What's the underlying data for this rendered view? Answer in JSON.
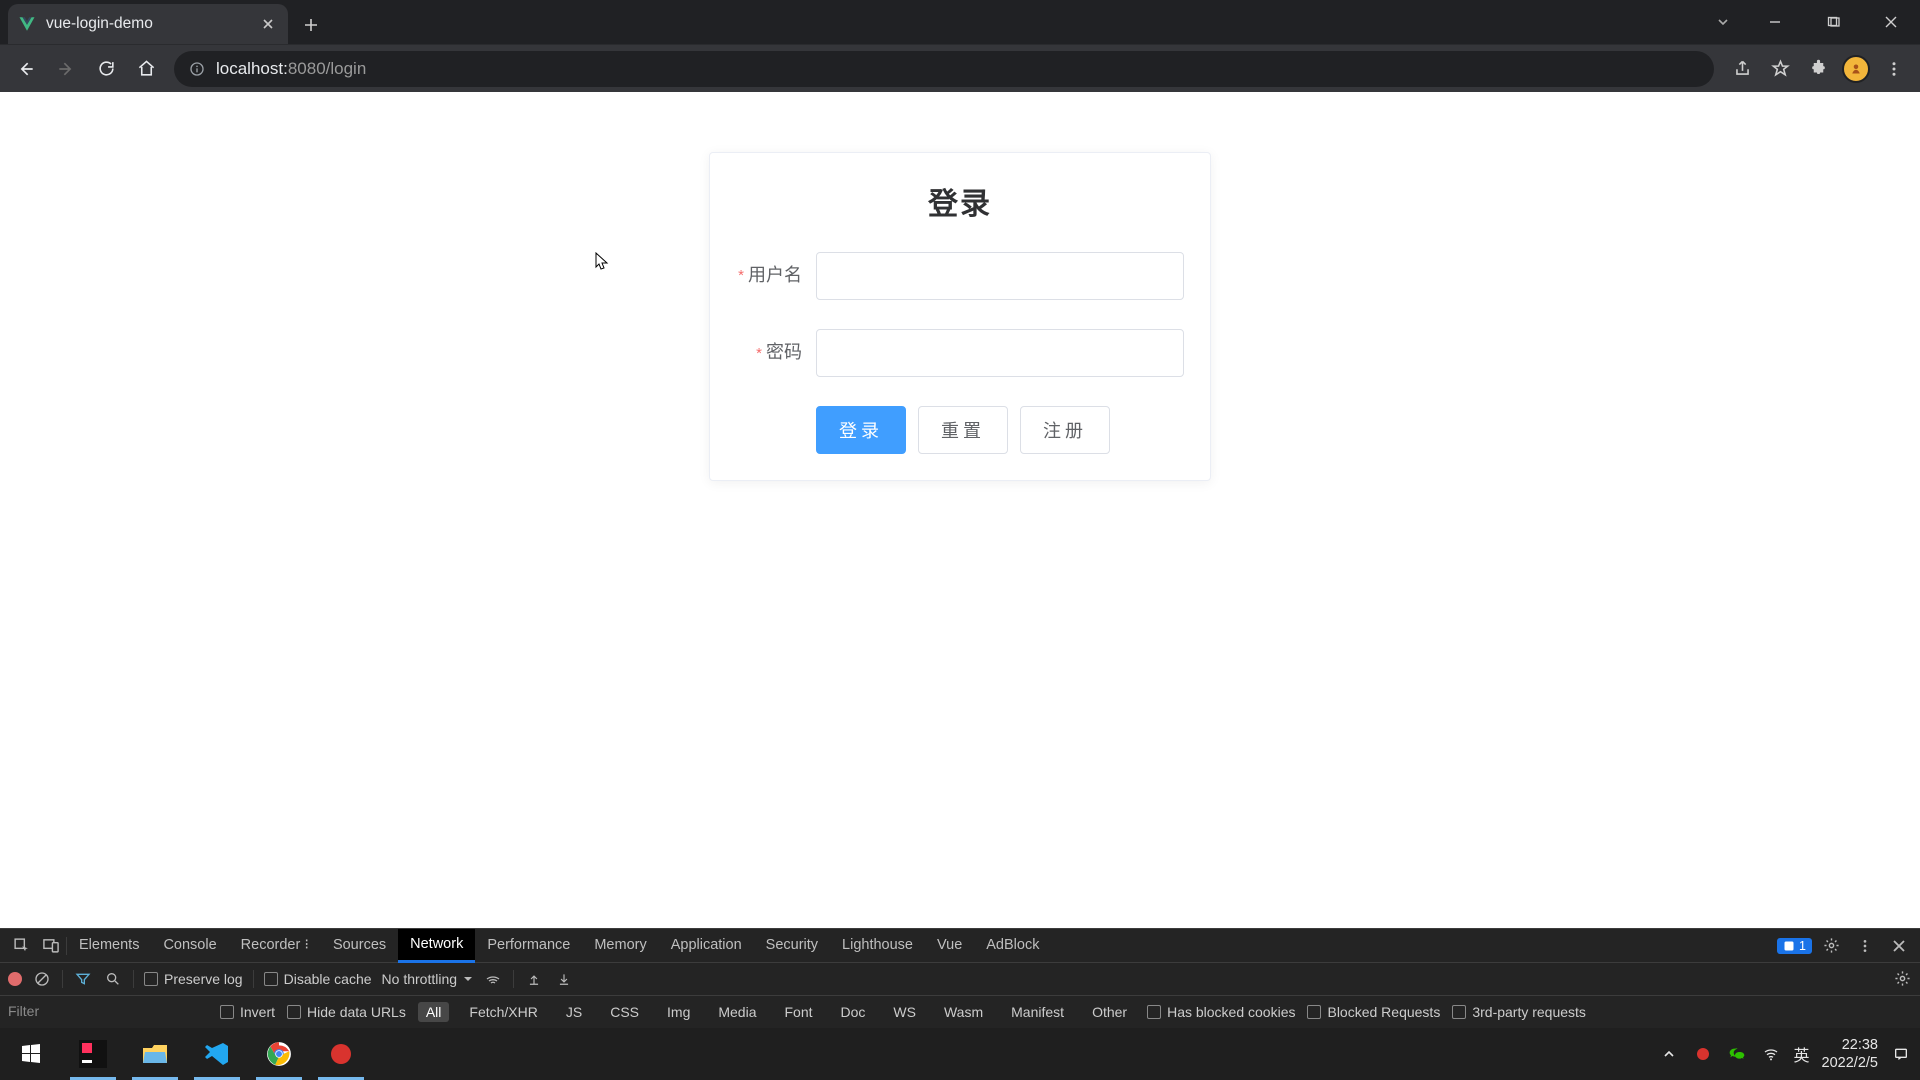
{
  "browser": {
    "tab_title": "vue-login-demo",
    "url_host": "localhost:",
    "url_port_path": "8080/login"
  },
  "page": {
    "title": "登录",
    "username_label": "用户名",
    "password_label": "密码",
    "username_value": "",
    "password_value": "",
    "btn_login": "登录",
    "btn_reset": "重置",
    "btn_register": "注册"
  },
  "devtools": {
    "tabs": {
      "elements": "Elements",
      "console": "Console",
      "recorder": "Recorder",
      "sources": "Sources",
      "network": "Network",
      "performance": "Performance",
      "memory": "Memory",
      "application": "Application",
      "security": "Security",
      "lighthouse": "Lighthouse",
      "vue": "Vue",
      "adblock": "AdBlock"
    },
    "issues_count": "1",
    "toolbar": {
      "preserve_log": "Preserve log",
      "disable_cache": "Disable cache",
      "throttling": "No throttling"
    },
    "filter": {
      "placeholder": "Filter",
      "invert": "Invert",
      "hide_data_urls": "Hide data URLs",
      "types": {
        "all": "All",
        "fetchxhr": "Fetch/XHR",
        "js": "JS",
        "css": "CSS",
        "img": "Img",
        "media": "Media",
        "font": "Font",
        "doc": "Doc",
        "ws": "WS",
        "wasm": "Wasm",
        "manifest": "Manifest",
        "other": "Other"
      },
      "blocked_cookies": "Has blocked cookies",
      "blocked_requests": "Blocked Requests",
      "third_party": "3rd-party requests"
    }
  },
  "system": {
    "ime": "英",
    "time": "22:38",
    "date": "2022/2/5"
  }
}
